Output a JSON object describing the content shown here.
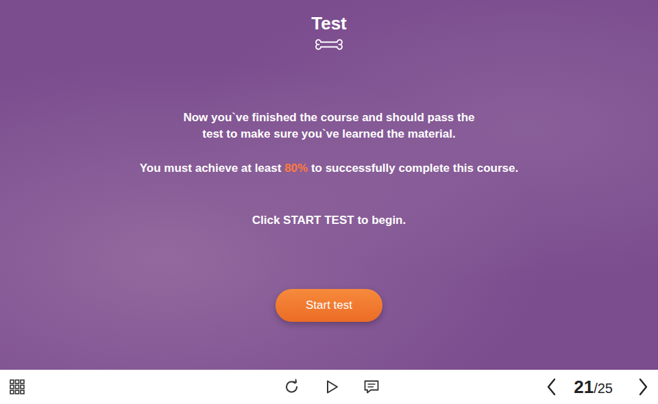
{
  "slide": {
    "title": "Test",
    "lines": [
      "Now you`ve finished the course and should pass the",
      "test to make sure you`ve learned the material."
    ],
    "requirement": {
      "before": "You must achieve at least ",
      "highlight": "80%",
      "after": " to successfully complete this course."
    },
    "instruction": "Click START TEST to begin.",
    "button": "Start test"
  },
  "player": {
    "current": "21",
    "total": "/25"
  }
}
